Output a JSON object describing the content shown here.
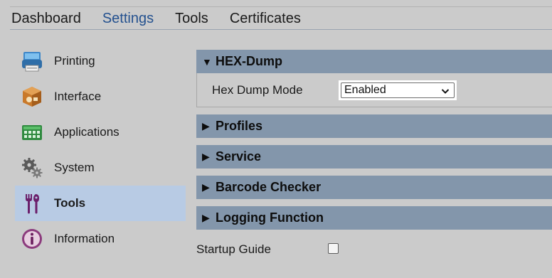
{
  "nav": {
    "items": [
      "Dashboard",
      "Settings",
      "Tools",
      "Certificates"
    ],
    "active": "Settings"
  },
  "sidebar": {
    "items": [
      {
        "label": "Printing",
        "icon": "printer-icon"
      },
      {
        "label": "Interface",
        "icon": "interface-icon"
      },
      {
        "label": "Applications",
        "icon": "applications-icon"
      },
      {
        "label": "System",
        "icon": "gear-icon"
      },
      {
        "label": "Tools",
        "icon": "tools-icon",
        "active": true
      },
      {
        "label": "Information",
        "icon": "info-icon"
      }
    ]
  },
  "sections": {
    "hexdump": {
      "title": "HEX-Dump",
      "expanded": true,
      "field_label": "Hex Dump Mode",
      "field_value": "Enabled"
    },
    "profiles": {
      "title": "Profiles",
      "expanded": false
    },
    "service": {
      "title": "Service",
      "expanded": false
    },
    "barcode": {
      "title": "Barcode Checker",
      "expanded": false
    },
    "logging": {
      "title": "Logging Function",
      "expanded": false
    }
  },
  "expanded_marker": "▼",
  "collapsed_marker": "▶",
  "startup": {
    "label": "Startup Guide",
    "checked": false
  },
  "colors": {
    "background": "#cbcbcb",
    "nav_active": "#24518f",
    "section_header": "#8396ab",
    "sidebar_active": "#b8cbe4"
  }
}
